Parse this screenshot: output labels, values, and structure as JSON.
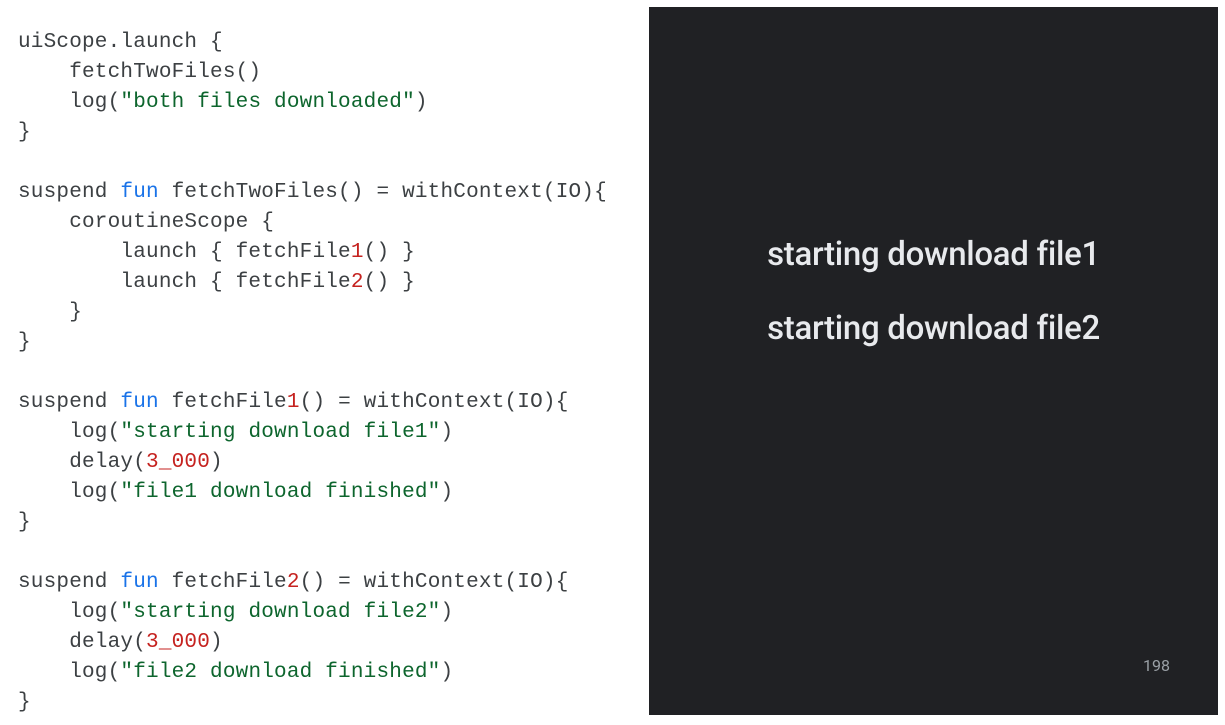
{
  "code": {
    "lines": [
      [
        {
          "t": "uiScope.launch {",
          "c": "plain"
        }
      ],
      [
        {
          "t": "    fetchTwoFiles()",
          "c": "plain"
        }
      ],
      [
        {
          "t": "    log(",
          "c": "plain"
        },
        {
          "t": "\"both files downloaded\"",
          "c": "str"
        },
        {
          "t": ")",
          "c": "plain"
        }
      ],
      [
        {
          "t": "}",
          "c": "plain"
        }
      ],
      [
        {
          "t": "",
          "c": "plain"
        }
      ],
      [
        {
          "t": "suspend ",
          "c": "plain"
        },
        {
          "t": "fun",
          "c": "kw"
        },
        {
          "t": " fetchTwoFiles() = withContext(IO){",
          "c": "plain"
        }
      ],
      [
        {
          "t": "    coroutineScope {",
          "c": "plain"
        }
      ],
      [
        {
          "t": "        launch { fetchFile",
          "c": "plain"
        },
        {
          "t": "1",
          "c": "num"
        },
        {
          "t": "() }",
          "c": "plain"
        }
      ],
      [
        {
          "t": "        launch { fetchFile",
          "c": "plain"
        },
        {
          "t": "2",
          "c": "num"
        },
        {
          "t": "() }",
          "c": "plain"
        }
      ],
      [
        {
          "t": "    }",
          "c": "plain"
        }
      ],
      [
        {
          "t": "}",
          "c": "plain"
        }
      ],
      [
        {
          "t": "",
          "c": "plain"
        }
      ],
      [
        {
          "t": "suspend ",
          "c": "plain"
        },
        {
          "t": "fun",
          "c": "kw"
        },
        {
          "t": " fetchFile",
          "c": "plain"
        },
        {
          "t": "1",
          "c": "num"
        },
        {
          "t": "() = withContext(IO){",
          "c": "plain"
        }
      ],
      [
        {
          "t": "    log(",
          "c": "plain"
        },
        {
          "t": "\"starting download file1\"",
          "c": "str"
        },
        {
          "t": ")",
          "c": "plain"
        }
      ],
      [
        {
          "t": "    delay(",
          "c": "plain"
        },
        {
          "t": "3_000",
          "c": "num"
        },
        {
          "t": ")",
          "c": "plain"
        }
      ],
      [
        {
          "t": "    log(",
          "c": "plain"
        },
        {
          "t": "\"file1 download finished\"",
          "c": "str"
        },
        {
          "t": ")",
          "c": "plain"
        }
      ],
      [
        {
          "t": "}",
          "c": "plain"
        }
      ],
      [
        {
          "t": "",
          "c": "plain"
        }
      ],
      [
        {
          "t": "suspend ",
          "c": "plain"
        },
        {
          "t": "fun",
          "c": "kw"
        },
        {
          "t": " fetchFile",
          "c": "plain"
        },
        {
          "t": "2",
          "c": "num"
        },
        {
          "t": "() = withContext(IO){",
          "c": "plain"
        }
      ],
      [
        {
          "t": "    log(",
          "c": "plain"
        },
        {
          "t": "\"starting download file2\"",
          "c": "str"
        },
        {
          "t": ")",
          "c": "plain"
        }
      ],
      [
        {
          "t": "    delay(",
          "c": "plain"
        },
        {
          "t": "3_000",
          "c": "num"
        },
        {
          "t": ")",
          "c": "plain"
        }
      ],
      [
        {
          "t": "    log(",
          "c": "plain"
        },
        {
          "t": "\"file2 download finished\"",
          "c": "str"
        },
        {
          "t": ")",
          "c": "plain"
        }
      ],
      [
        {
          "t": "}",
          "c": "plain"
        }
      ]
    ]
  },
  "output": {
    "lines": [
      "starting download file1",
      "starting download file2"
    ]
  },
  "page_number": "198"
}
